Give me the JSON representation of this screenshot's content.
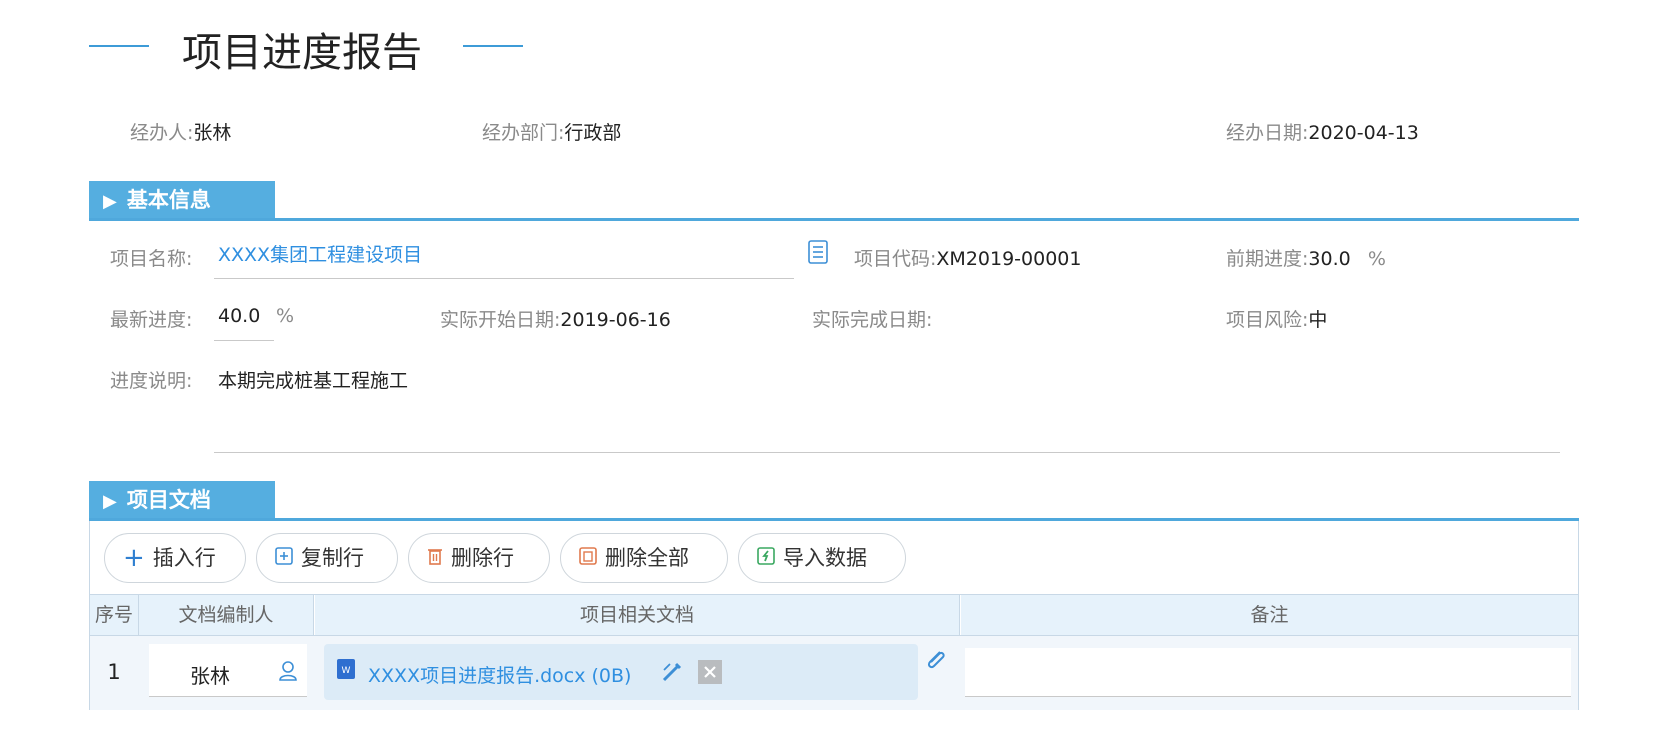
{
  "header": {
    "title": "项目进度报告"
  },
  "meta": {
    "handler_label": "经办人:",
    "handler_value": "张林",
    "dept_label": "经办部门:",
    "dept_value": "行政部",
    "date_label": "经办日期:",
    "date_value": "2020-04-13"
  },
  "basic": {
    "section_title": "基本信息",
    "project_name_label": "项目名称:",
    "project_name_value": "XXXX集团工程建设项目",
    "project_code_label": "项目代码:",
    "project_code_value": "XM2019-00001",
    "prev_progress_label": "前期进度:",
    "prev_progress_value": "30.0",
    "prev_progress_unit": "%",
    "latest_progress_label": "最新进度:",
    "latest_progress_value": "40.0",
    "latest_progress_unit": "%",
    "actual_start_label": "实际开始日期:",
    "actual_start_value": "2019-06-16",
    "actual_end_label": "实际完成日期:",
    "risk_label": "项目风险:",
    "risk_value": "中",
    "desc_label": "进度说明:",
    "desc_value": "本期完成桩基工程施工"
  },
  "docs": {
    "section_title": "项目文档",
    "toolbar": {
      "insert_row": "插入行",
      "copy_row": "复制行",
      "delete_row": "删除行",
      "delete_all": "删除全部",
      "import_data": "导入数据"
    },
    "columns": [
      "序号",
      "文档编制人",
      "项目相关文档",
      "备注"
    ],
    "rows": [
      {
        "no": "1",
        "author": "张林",
        "file": "XXXX项目进度报告.docx (0B)",
        "note": ""
      }
    ]
  },
  "colors": {
    "accent": "#4fa8dc",
    "link": "#2f8fe0"
  }
}
